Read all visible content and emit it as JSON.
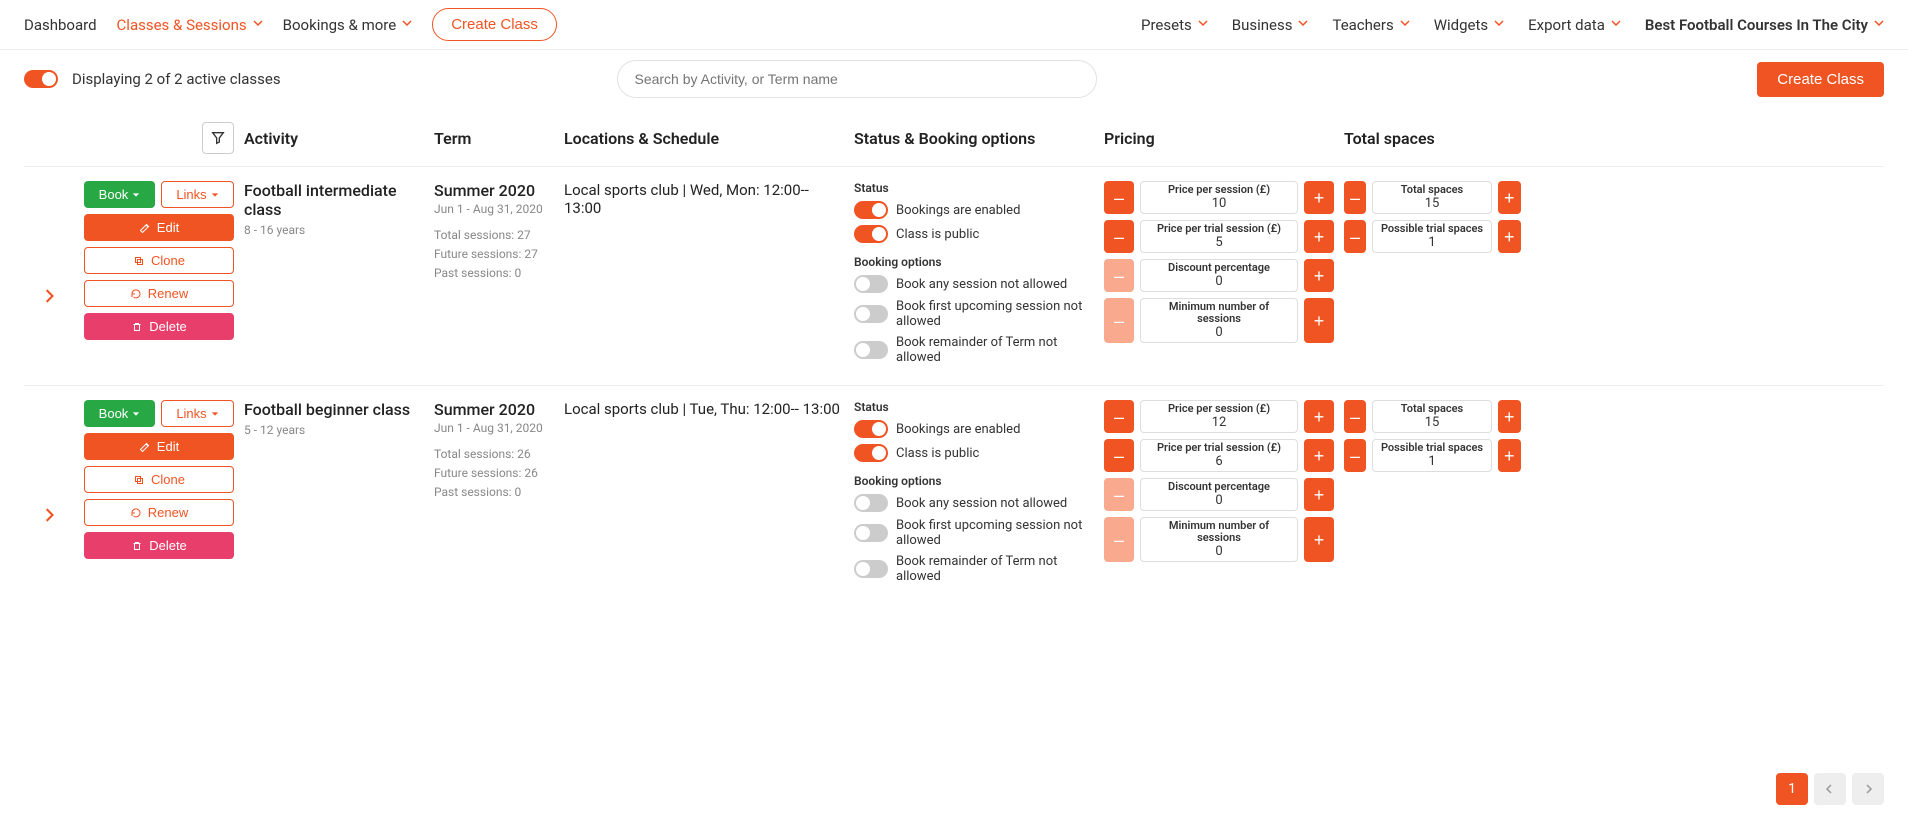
{
  "nav": {
    "dashboard": "Dashboard",
    "classes": "Classes & Sessions",
    "bookings": "Bookings & more",
    "create": "Create Class",
    "presets": "Presets",
    "business": "Business",
    "teachers": "Teachers",
    "widgets": "Widgets",
    "export": "Export data",
    "brand": "Best Football Courses In The City"
  },
  "subbar": {
    "displaying": "Displaying 2 of 2 active classes",
    "search_placeholder": "Search by Activity, or Term name",
    "create_btn": "Create Class"
  },
  "headers": {
    "activity": "Activity",
    "term": "Term",
    "locations": "Locations & Schedule",
    "status": "Status & Booking options",
    "pricing": "Pricing",
    "spaces": "Total spaces"
  },
  "action_labels": {
    "book": "Book",
    "links": "Links",
    "edit": "Edit",
    "clone": "Clone",
    "renew": "Renew",
    "delete": "Delete"
  },
  "status_labels": {
    "status": "Status",
    "bookings_enabled": "Bookings are enabled",
    "class_public": "Class is public",
    "booking_options": "Booking options",
    "any_session": "Book any session not allowed",
    "first_upcoming": "Book first upcoming session not allowed",
    "remainder": "Book remainder of Term not allowed"
  },
  "pricing_labels": {
    "per_session": "Price per session (£)",
    "per_trial": "Price per trial session (£)",
    "discount": "Discount percentage",
    "min_sessions": "Minimum number of sessions"
  },
  "spaces_labels": {
    "total": "Total spaces",
    "trial": "Possible trial spaces"
  },
  "classes": [
    {
      "title": "Football intermediate class",
      "age": "8 - 16 years",
      "term_title": "Summer 2020",
      "term_dates": "Jun 1 - Aug 31, 2020",
      "total_sessions": "Total sessions: 27",
      "future_sessions": "Future sessions: 27",
      "past_sessions": "Past sessions: 0",
      "schedule": "Local sports club | Wed, Mon: 12:00-- 13:00",
      "pricing": {
        "per_session": "10",
        "per_trial": "5",
        "discount": "0",
        "min_sessions": "0"
      },
      "spaces": {
        "total": "15",
        "trial": "1"
      }
    },
    {
      "title": "Football beginner class",
      "age": "5 - 12 years",
      "term_title": "Summer 2020",
      "term_dates": "Jun 1 - Aug 31, 2020",
      "total_sessions": "Total sessions: 26",
      "future_sessions": "Future sessions: 26",
      "past_sessions": "Past sessions: 0",
      "schedule": "Local sports club | Tue, Thu: 12:00-- 13:00",
      "pricing": {
        "per_session": "12",
        "per_trial": "6",
        "discount": "0",
        "min_sessions": "0"
      },
      "spaces": {
        "total": "15",
        "trial": "1"
      }
    }
  ],
  "pager": {
    "current": "1"
  }
}
